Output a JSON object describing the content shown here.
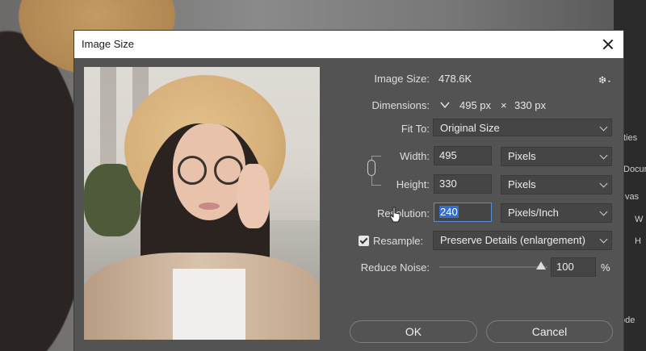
{
  "background_panel": {
    "labels": [
      "ties",
      "Docum",
      "vas",
      "W",
      "H",
      "ode"
    ]
  },
  "dialog": {
    "title": "Image Size",
    "image_size_label": "Image Size:",
    "image_size_value": "478.6K",
    "dimensions_label": "Dimensions:",
    "dimensions_width": "495 px",
    "dimensions_times": "×",
    "dimensions_height": "330 px",
    "fit_to_label": "Fit To:",
    "fit_to_value": "Original Size",
    "width_label": "Width:",
    "width_value": "495",
    "width_unit": "Pixels",
    "height_label": "Height:",
    "height_value": "330",
    "height_unit": "Pixels",
    "resolution_label": "Resolution:",
    "resolution_value": "240",
    "resolution_unit": "Pixels/Inch",
    "resample_label": "Resample:",
    "resample_checked": true,
    "resample_value": "Preserve Details (enlargement)",
    "reduce_noise_label": "Reduce Noise:",
    "reduce_noise_value": "100",
    "reduce_noise_unit": "%",
    "reduce_noise_level": 100,
    "ok_label": "OK",
    "cancel_label": "Cancel"
  },
  "icons": {
    "close": "close-icon",
    "gear": "gear-icon",
    "dimensions_toggle": "chevron-down-icon",
    "link": "chain-link-icon",
    "cursor": "hand-pointer-icon"
  },
  "colors": {
    "dialog_bg": "#535353",
    "field_bg": "#454545",
    "selection": "#2f6fd6",
    "titlebar": "#ffffff"
  }
}
